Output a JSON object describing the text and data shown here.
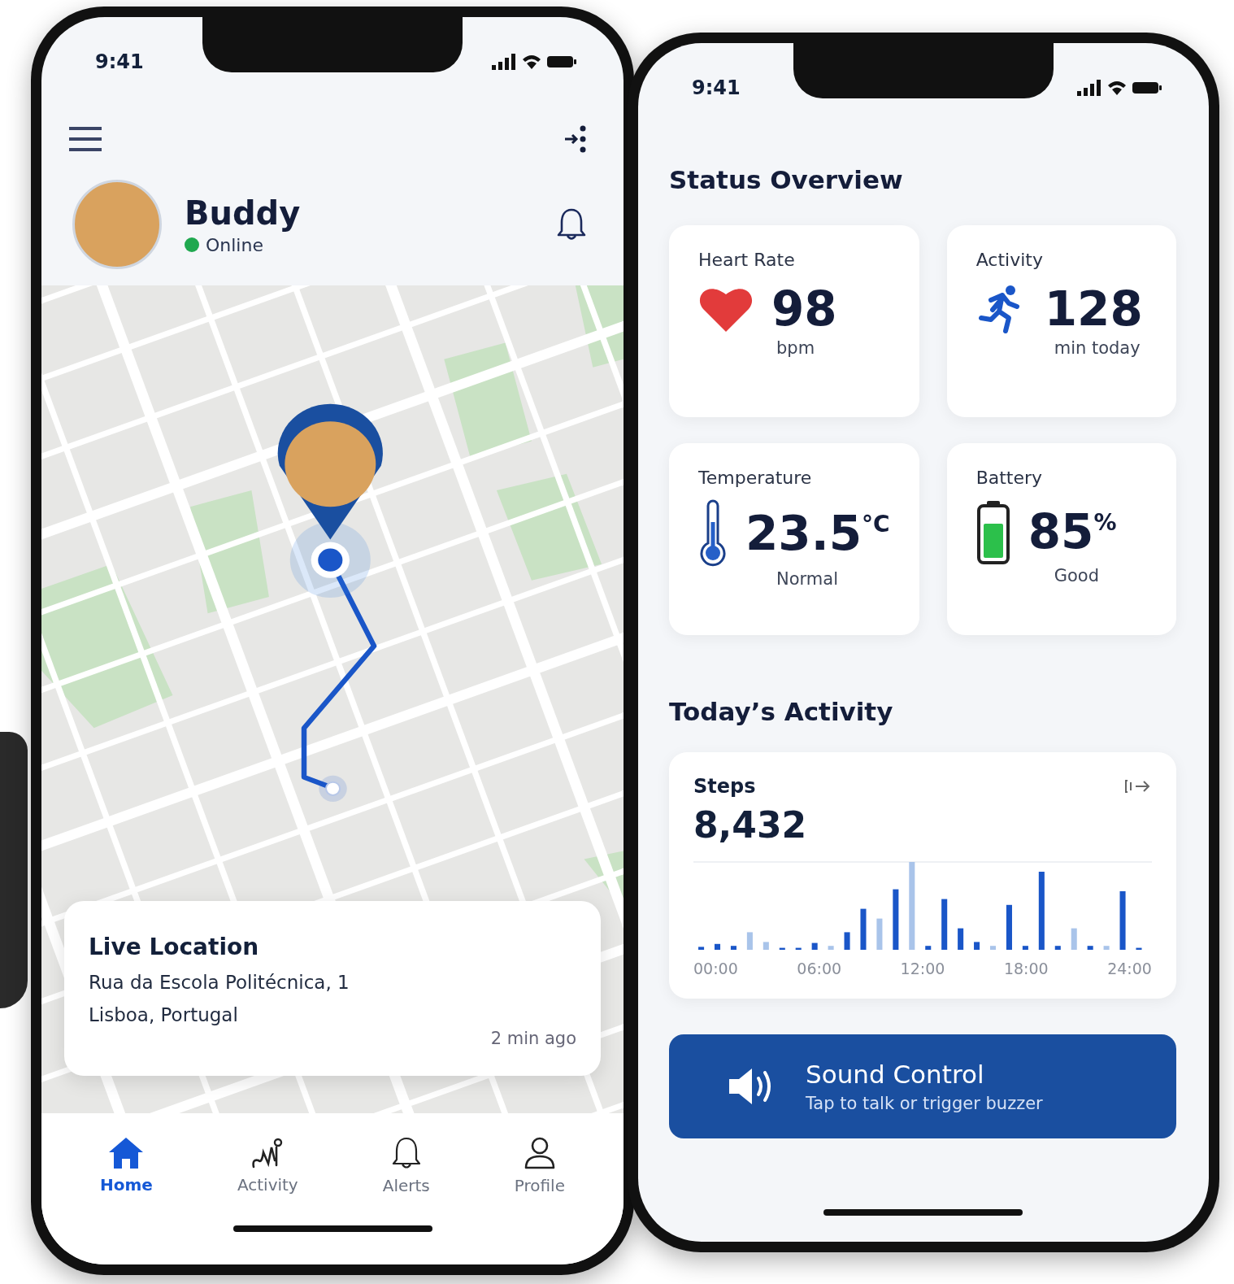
{
  "left_phone": {
    "status_bar": {
      "time": "9:41"
    },
    "pet": {
      "name": "Buddy",
      "status": "Online"
    },
    "live_location": {
      "title": "Live Location",
      "address_line_1": "Rua da Escola Politécnica, 1",
      "address_line_2": "Lisboa, Portugal",
      "updated": "2 min ago"
    },
    "tabs": [
      {
        "kind": "home",
        "label": "Home",
        "selected": true
      },
      {
        "kind": "activity",
        "label": "Activity",
        "selected": false
      },
      {
        "kind": "alerts",
        "label": "Alerts",
        "selected": false
      },
      {
        "kind": "profile",
        "label": "Profile",
        "selected": false
      }
    ]
  },
  "right_phone": {
    "status_bar": {
      "time": "9:41"
    },
    "title": "Status Overview",
    "metrics": [
      {
        "kind": "heart",
        "label": "Heart Rate",
        "value": "98",
        "caption": "bpm"
      },
      {
        "kind": "activity",
        "label": "Activity",
        "value": "128",
        "caption": "min today"
      },
      {
        "kind": "temperature",
        "label": "Temperature",
        "value": "23.5",
        "suffix": "°C",
        "caption": "Normal"
      },
      {
        "kind": "battery",
        "label": "Battery",
        "value": "85",
        "suffix": "%",
        "caption": "Good"
      }
    ],
    "activity_title": "Today’s Activity",
    "steps": {
      "title": "Steps",
      "value": "8,432",
      "x_labels": [
        "00:00",
        "06:00",
        "12:00",
        "18:00",
        "24:00"
      ]
    },
    "sound_control": {
      "title": "Sound Control",
      "subtitle": "Tap to talk or trigger buzzer"
    }
  }
}
